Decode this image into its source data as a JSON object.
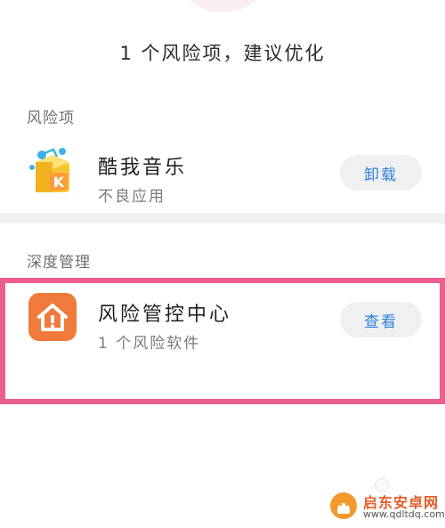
{
  "summary": {
    "text": "1 个风险项，建议优化"
  },
  "risk_section": {
    "title": "风险项",
    "item": {
      "icon": "kuwo-music-icon",
      "name": "酷我音乐",
      "description": "不良应用",
      "action_label": "卸载"
    }
  },
  "deep_section": {
    "title": "深度管理",
    "item": {
      "icon": "home-warning-icon",
      "name": "风险管控中心",
      "description": "1 个风险软件",
      "action_label": "查看"
    }
  },
  "watermark": {
    "name": "启东安卓网",
    "url": "www.qdltdq.com",
    "icon": "android-logo-icon"
  },
  "colors": {
    "accent": "#2f7fd8",
    "highlight": "#ec5f8d",
    "icon_orange": "#f07a3c",
    "button_bg": "#eef0f2"
  }
}
